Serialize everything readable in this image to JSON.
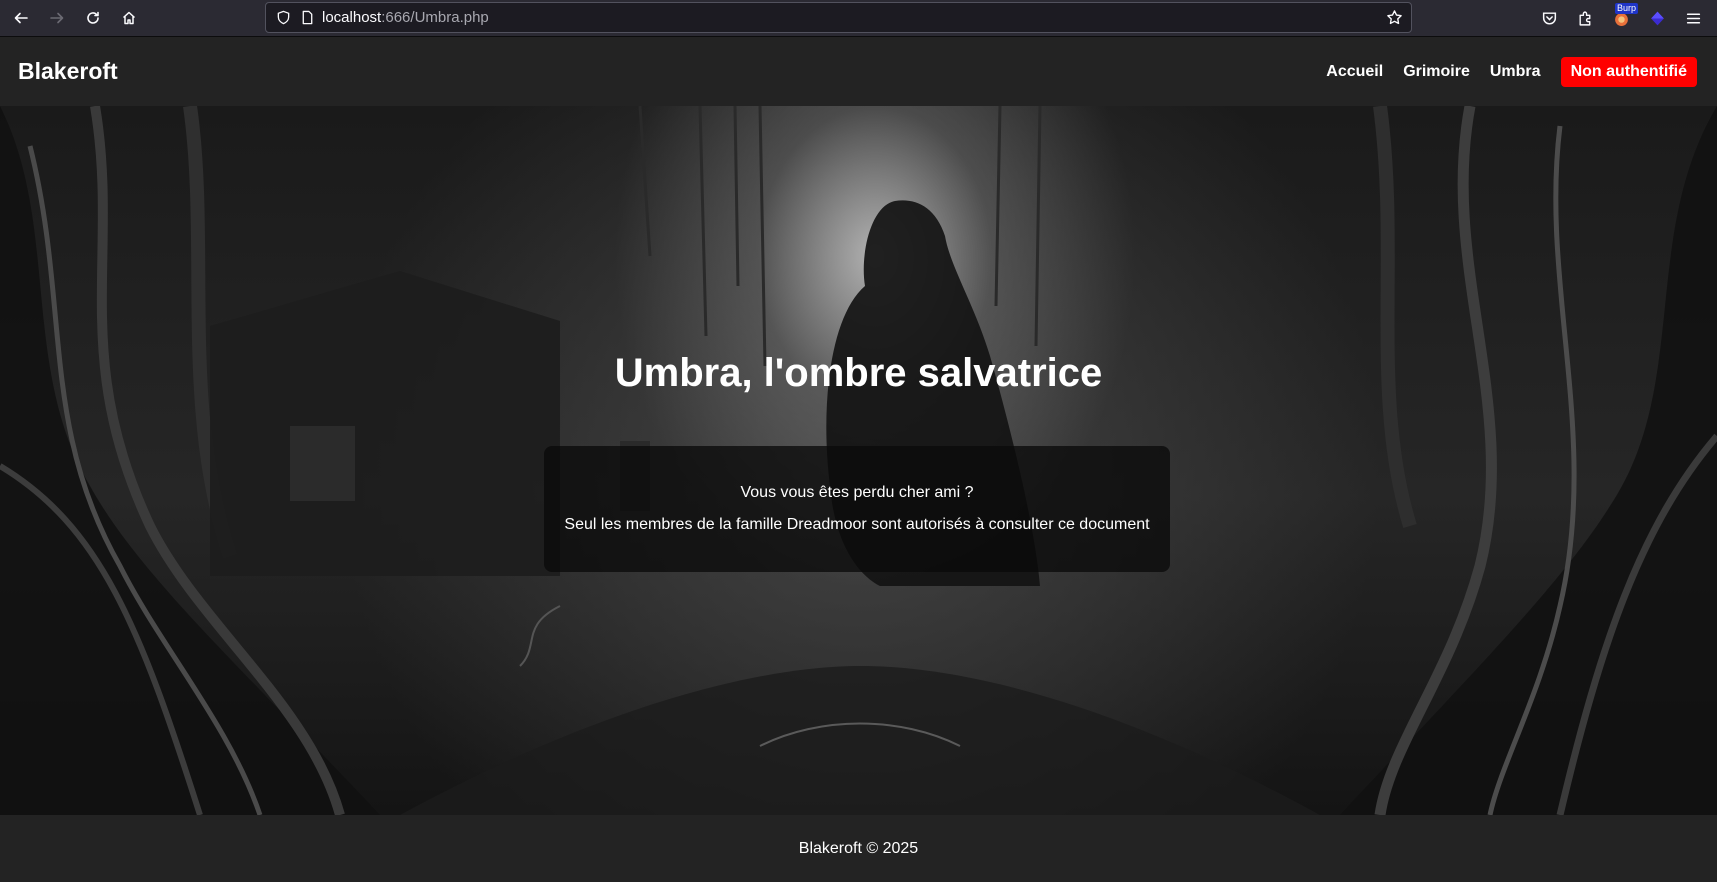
{
  "browser": {
    "url_host": "localhost",
    "url_rest": ":666/Umbra.php",
    "extension_badge": "Burp"
  },
  "site": {
    "brand": "Blakeroft",
    "nav": {
      "home": "Accueil",
      "grimoire": "Grimoire",
      "umbra": "Umbra",
      "auth_status": "Non authentifié"
    },
    "accent_color": "#ff0000"
  },
  "hero": {
    "title": "Umbra, l'ombre salvatrice",
    "message_line1": "Vous vous êtes perdu cher ami ?",
    "message_line2": "Seul les membres de la famille Dreadmoor sont autorisés à consulter ce document"
  },
  "footer": {
    "text": "Blakeroft © 2025"
  }
}
